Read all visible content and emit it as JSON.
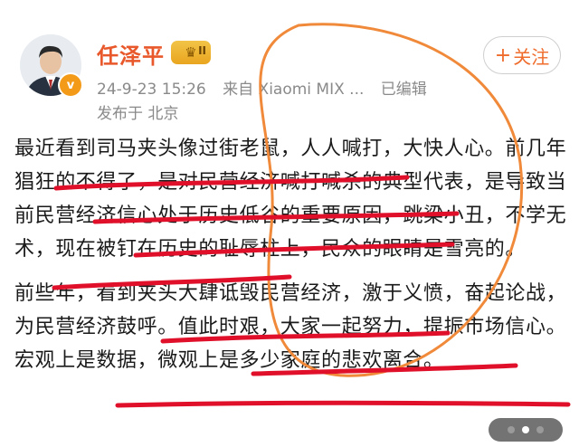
{
  "author": {
    "name": "任泽平",
    "level_badge": "II",
    "verified_mark": "v",
    "avatar_icon": "person-portrait-icon"
  },
  "post_meta": {
    "timestamp": "24-9-23 15:26",
    "source": "来自 Xiaomi MIX ...",
    "edited": "已编辑",
    "location": "发布于 北京"
  },
  "follow_button": {
    "label": "关注",
    "icon": "plus-icon"
  },
  "content": {
    "paragraph1": "最近看到司马夹头像过街老鼠，人人喊打，大快人心。前几年猖狂的不得了，是对民营经济喊打喊杀的典型代表，是导致当前民营经济信心处于历史低谷的重要原因，跳梁小丑，不学无术，现在被钉在历史的耻辱柱上，民众的眼睛是雪亮的。",
    "paragraph2": "前些年，看到夹头大肆诋毁民营经济，激于义愤，奋起论战，为民营经济鼓呼。值此时艰，大家一起努力，提振市场信心。宏观上是数据，微观上是多少家庭的悲欢离合。"
  },
  "annotations": {
    "ellipse_color": "#f08a3a",
    "underline_color": "#e0102a"
  },
  "image_pager": {
    "count": 3,
    "active": 1
  }
}
